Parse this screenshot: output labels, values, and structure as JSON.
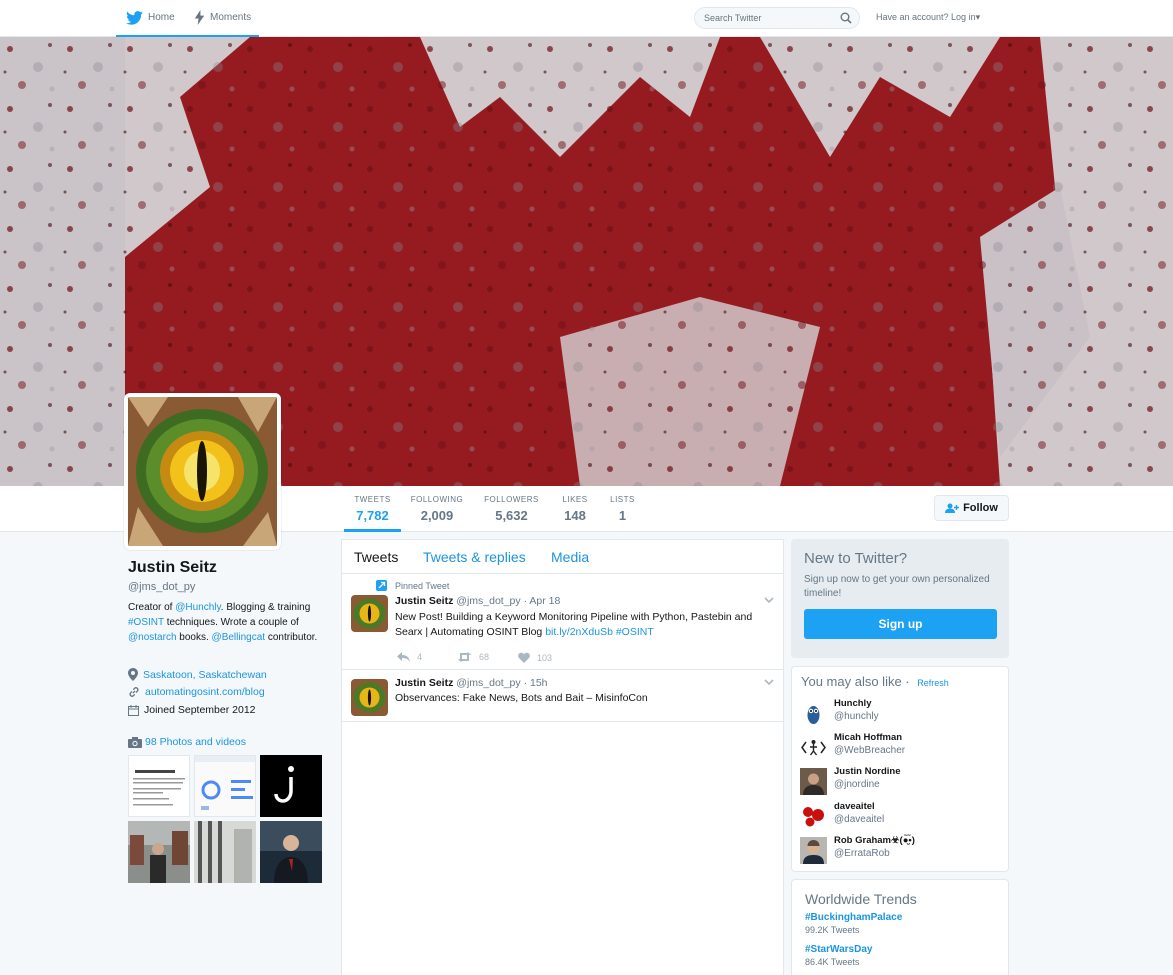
{
  "nav": {
    "home_label": "Home",
    "moments_label": "Moments",
    "search_placeholder": "Search Twitter",
    "login_label": "Have an account? Log in"
  },
  "stats": [
    {
      "label": "TWEETS",
      "value": "7,782",
      "active": true
    },
    {
      "label": "FOLLOWING",
      "value": "2,009"
    },
    {
      "label": "FOLLOWERS",
      "value": "5,632"
    },
    {
      "label": "LIKES",
      "value": "148"
    },
    {
      "label": "LISTS",
      "value": "1"
    }
  ],
  "follow_label": "Follow",
  "profile": {
    "name": "Justin Seitz",
    "handle": "@jms_dot_py",
    "bio": {
      "p1": "Creator of ",
      "link_hunchly": "@Hunchly",
      "p2": ". Blogging & training ",
      "link_osint": "#OSINT",
      "p3": " techniques. Wrote a couple of ",
      "link_nostarch": "@nostarch",
      "p4": " books. ",
      "link_bellingcat": "@Bellingcat",
      "p5": " contributor."
    },
    "location": "Saskatoon, Saskatchewan",
    "url": "automatingosint.com/blog",
    "joined": "Joined September 2012",
    "photos_label": "98 Photos and videos"
  },
  "timeline": {
    "tabs": [
      "Tweets",
      "Tweets & replies",
      "Media"
    ],
    "tweets": [
      {
        "pinned_label": "Pinned Tweet",
        "name": "Justin Seitz",
        "handle": "@jms_dot_py",
        "time": "Apr 18",
        "text": "New Post! Building a Keyword Monitoring Pipeline with Python, Pastebin and Searx | Automating OSINT Blog ",
        "link1": "bit.ly/2nXduSb",
        "link2": "#OSINT",
        "replies": "4",
        "retweets": "68",
        "likes": "103"
      },
      {
        "name": "Justin Seitz",
        "handle": "@jms_dot_py",
        "time": "15h",
        "text": "Observances: Fake News, Bots and Bait – MisinfoCon"
      }
    ]
  },
  "signup": {
    "title": "New to Twitter?",
    "subtitle": "Sign up now to get your own personalized timeline!",
    "button": "Sign up"
  },
  "suggestions": {
    "title": "You may also like",
    "refresh": "Refresh",
    "users": [
      {
        "name": "Hunchly",
        "handle": "@hunchly"
      },
      {
        "name": "Micah Hoffman",
        "handle": "@WebBreacher"
      },
      {
        "name": "Justin Nordine",
        "handle": "@jnordine"
      },
      {
        "name": "daveaitel",
        "handle": "@daveaitel"
      },
      {
        "name": "Rob Graham☣(●̮̮̃•̃)",
        "handle": "@ErrataRob"
      }
    ]
  },
  "trends": {
    "title": "Worldwide Trends",
    "items": [
      {
        "name": "#BuckinghamPalace",
        "count": "99.2K Tweets"
      },
      {
        "name": "#StarWarsDay",
        "count": "86.4K Tweets"
      }
    ]
  }
}
